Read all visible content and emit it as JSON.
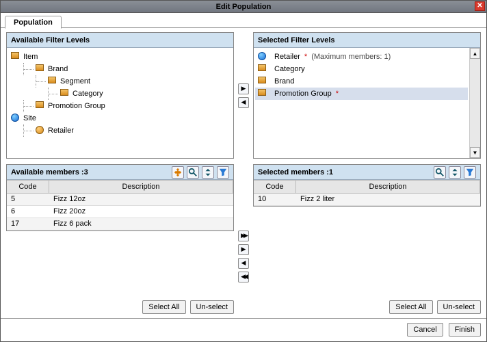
{
  "dialog": {
    "title": "Edit Population",
    "close": "x"
  },
  "tabs": {
    "population": "Population"
  },
  "available_levels": {
    "title": "Available Filter Levels",
    "tree": {
      "item": "Item",
      "brand": "Brand",
      "segment": "Segment",
      "category": "Category",
      "promotion_group": "Promotion Group",
      "site": "Site",
      "retailer": "Retailer"
    }
  },
  "selected_levels": {
    "title": "Selected Filter Levels",
    "items": [
      {
        "label": "Retailer",
        "required": true,
        "annot": "(Maximum members: 1)",
        "icon": "globe"
      },
      {
        "label": "Category",
        "required": false,
        "icon": "box"
      },
      {
        "label": "Brand",
        "required": false,
        "icon": "box"
      },
      {
        "label": "Promotion Group",
        "required": true,
        "icon": "box",
        "selected": true
      }
    ]
  },
  "available_members": {
    "title": "Available members :3",
    "cols": {
      "code": "Code",
      "desc": "Description"
    },
    "rows": [
      {
        "code": "5",
        "desc": "Fizz 12oz"
      },
      {
        "code": "6",
        "desc": "Fizz 20oz"
      },
      {
        "code": "17",
        "desc": "Fizz 6 pack"
      }
    ],
    "select_all": "Select All",
    "unselect": "Un-select"
  },
  "selected_members": {
    "title": "Selected members :1",
    "cols": {
      "code": "Code",
      "desc": "Description"
    },
    "rows": [
      {
        "code": "10",
        "desc": "Fizz 2 liter"
      }
    ],
    "select_all": "Select All",
    "unselect": "Un-select"
  },
  "move": {
    "right": "▶",
    "left": "◀",
    "all_right": "▶▶",
    "one_right": "▶",
    "one_left": "◀",
    "all_left": "◀◀"
  },
  "footer": {
    "cancel": "Cancel",
    "finish": "Finish"
  }
}
